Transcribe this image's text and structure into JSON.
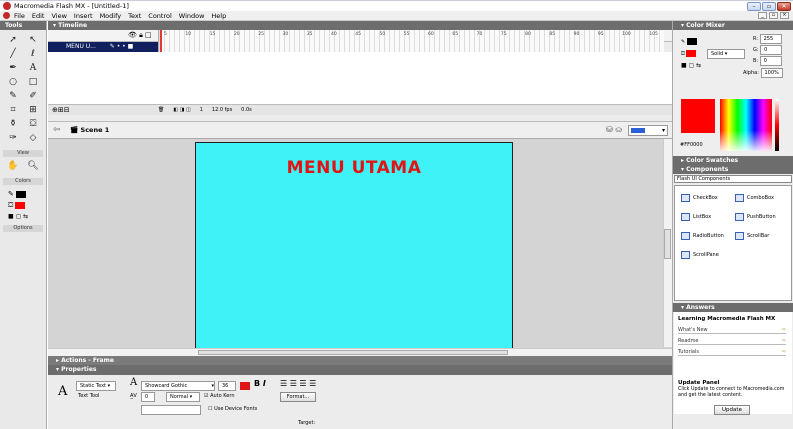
{
  "window": {
    "title": "Macromedia Flash MX - [Untitled-1]"
  },
  "menubar": {
    "items": [
      "File",
      "Edit",
      "View",
      "Insert",
      "Modify",
      "Text",
      "Control",
      "Window",
      "Help"
    ]
  },
  "tools": {
    "title": "Tools",
    "sections": {
      "view": "View",
      "colors": "Colors",
      "options": "Options"
    },
    "icons": [
      "arrow",
      "subselect",
      "line",
      "lasso",
      "pen",
      "text",
      "oval",
      "rectangle",
      "pencil",
      "brush",
      "free-transform",
      "fill-transform",
      "ink-bottle",
      "paint-bucket",
      "eyedropper",
      "eraser",
      "hand",
      "zoom"
    ]
  },
  "timeline": {
    "title": "Timeline",
    "layer_name": "MENU U...",
    "ruler": [
      "5",
      "10",
      "15",
      "20",
      "25",
      "30",
      "35",
      "40",
      "45",
      "50",
      "55",
      "60",
      "65",
      "70",
      "75",
      "80",
      "85",
      "90",
      "95",
      "100",
      "105"
    ],
    "frame": "1",
    "fps": "12.0 fps",
    "time": "0.0s"
  },
  "editbar": {
    "scene": "Scene 1",
    "zoom": "100%"
  },
  "stage": {
    "title": "MENU UTAMA",
    "background": "#3ef2f7",
    "title_color": "#e01414"
  },
  "panels": {
    "actions": "Actions - Frame",
    "properties": "Properties"
  },
  "properties": {
    "text_type": "Static Text",
    "instance": "Text Tool",
    "font": "Showcard Gothic",
    "size": "36",
    "spacing": "0",
    "kerning_mode": "Normal",
    "auto_kern": "Auto Kern",
    "format_btn": "Format...",
    "device_fonts": "Use Device Fonts",
    "target": "Target:"
  },
  "color_mixer": {
    "title": "Color Mixer",
    "fill_type": "Solid",
    "r": "255",
    "g": "0",
    "b": "0",
    "alpha": "100%",
    "hex": "#FF0000"
  },
  "color_swatches": {
    "title": "Color Swatches"
  },
  "components": {
    "title": "Components",
    "set": "Flash UI Components",
    "items": [
      "CheckBox",
      "ComboBox",
      "ListBox",
      "PushButton",
      "RadioButton",
      "ScrollBar",
      "ScrollPane"
    ]
  },
  "answers": {
    "title": "Answers",
    "heading": "Learning Macromedia Flash MX",
    "links": [
      "What's New",
      "Readme",
      "Tutorials"
    ],
    "update_title": "Update Panel",
    "update_text": "Click Update to connect to Macromedia.com and get the latest content.",
    "update_btn": "Update"
  }
}
